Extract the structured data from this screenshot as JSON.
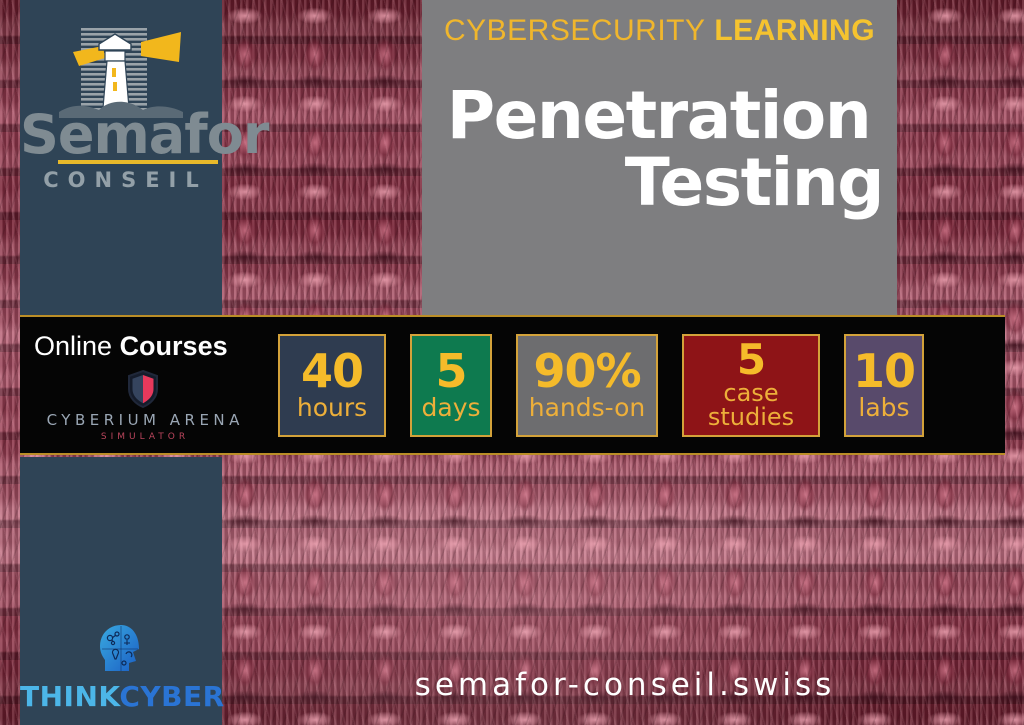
{
  "brand": {
    "logo_icon": "lighthouse-icon",
    "name": "Semafor",
    "tagline": "CONSEIL"
  },
  "header": {
    "eyebrow_light": "CYBERSECURITY",
    "eyebrow_bold": "LEARNING",
    "title_line1": "Penetration",
    "title_line2": "Testing"
  },
  "courses": {
    "label_light": "Online",
    "label_bold": "Courses",
    "platform_icon": "shield-icon",
    "platform_name": "CYBERIUM ARENA",
    "platform_sub": "SIMULATOR"
  },
  "badges": [
    {
      "value": "40",
      "unit": "hours",
      "bg": "#2f3c50",
      "border": "#d3a23a",
      "text": "#f5bb2a"
    },
    {
      "value": "5",
      "unit": "days",
      "bg": "#0e7a4f",
      "border": "#d3a23a",
      "text": "#f5bb2a"
    },
    {
      "value": "90%",
      "unit": "hands-on",
      "bg": "#6d6d6f",
      "border": "#d3a23a",
      "text": "#f5bb2a"
    },
    {
      "value": "5",
      "unit": "case\nstudies",
      "bg": "#8e1417",
      "border": "#d3a23a",
      "text": "#f5bb2a"
    },
    {
      "value": "10",
      "unit": "labs",
      "bg": "#584a6b",
      "border": "#d3a23a",
      "text": "#f5bb2a"
    }
  ],
  "partner": {
    "icon": "brain-head-icon",
    "name_part1": "THINK",
    "name_part2": "CYBER"
  },
  "footer": {
    "website": "semafor-conseil.swiss"
  },
  "colors": {
    "gold": "#f5bb2a",
    "panel_navy": "#2f4456",
    "title_panel_gray": "#7e7e80",
    "bar_black": "#050505",
    "border_gold": "#bb8e27",
    "texture_maroon": "#7d3144"
  }
}
